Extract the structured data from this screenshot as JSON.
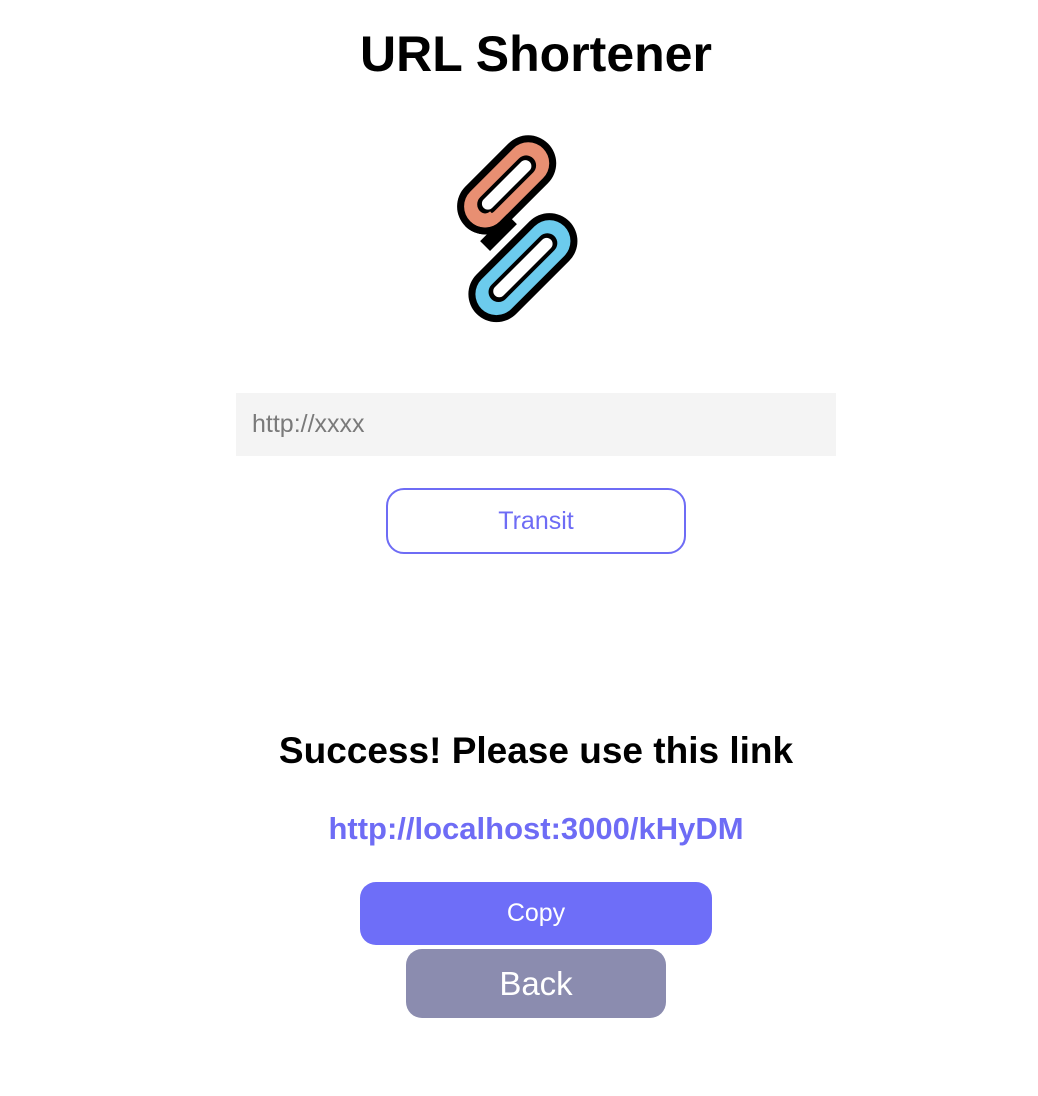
{
  "header": {
    "title": "URL Shortener"
  },
  "logo": {
    "icon": "link-chain-icon",
    "colors": {
      "front_link": "#6ccbed",
      "back_link": "#e88f72",
      "outline": "#000000"
    }
  },
  "form": {
    "url_input": {
      "value": "",
      "placeholder": "http://xxxx"
    },
    "transit_label": "Transit"
  },
  "result": {
    "heading": "Success! Please use this link",
    "short_url": "http://localhost:3000/kHyDM",
    "copy_label": "Copy",
    "back_label": "Back"
  },
  "colors": {
    "accent": "#6e6cf5",
    "secondary_button": "#8b8caf",
    "input_background": "#f4f4f4"
  }
}
